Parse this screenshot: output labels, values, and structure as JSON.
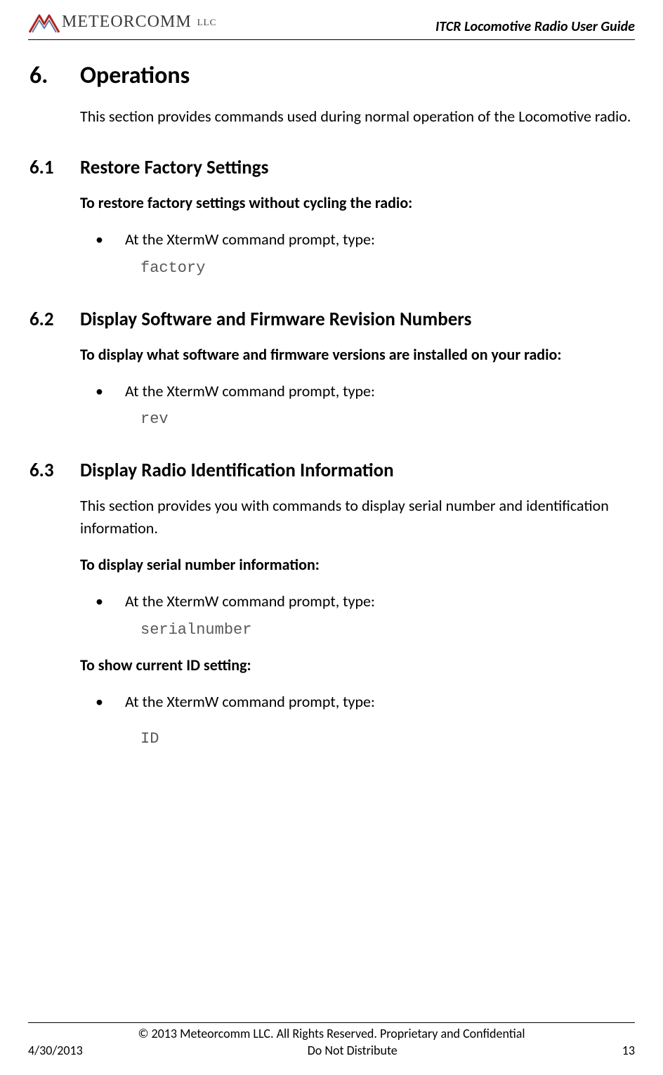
{
  "header": {
    "logo_name": "METEORCOMM",
    "logo_suffix": "LLC",
    "doc_title": "ITCR Locomotive Radio User Guide"
  },
  "sections": {
    "s6": {
      "num": "6.",
      "title": "Operations"
    },
    "s6_intro": "This section provides commands used during normal operation of the Locomotive radio.",
    "s61": {
      "num": "6.1",
      "title": "Restore Factory Settings"
    },
    "s61_bold": "To restore factory settings without cycling the radio:",
    "s61_step": "At the XtermW command prompt, type:",
    "s61_cmd": "factory",
    "s62": {
      "num": "6.2",
      "title": "Display Software and Firmware Revision Numbers"
    },
    "s62_bold": "To display what software and firmware versions are installed on your radio:",
    "s62_step": "At the XtermW command prompt, type:",
    "s62_cmd": "rev",
    "s63": {
      "num": "6.3",
      "title": "Display Radio Identification Information"
    },
    "s63_intro": "This section provides you with commands to display serial number and identification information.",
    "s63_bold1": "To display serial number information:",
    "s63_step1": "At the XtermW command prompt, type:",
    "s63_cmd1": "serialnumber",
    "s63_bold2": "To show current ID setting:",
    "s63_step2": "At the XtermW command prompt, type:",
    "s63_cmd2": "ID"
  },
  "footer": {
    "copyright": "© 2013 Meteorcomm LLC. All Rights Reserved. Proprietary and Confidential",
    "date": "4/30/2013",
    "center": "Do Not Distribute",
    "page": "13"
  }
}
